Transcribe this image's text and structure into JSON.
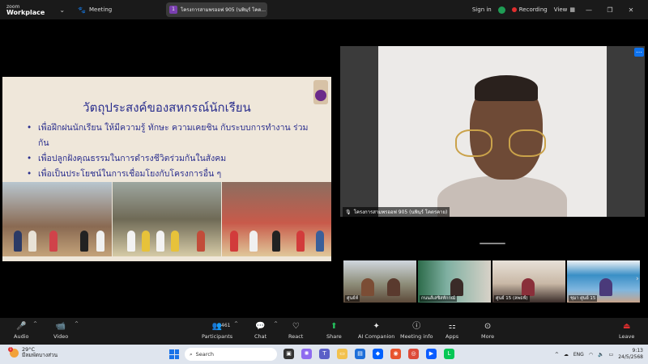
{
  "app": {
    "logo_line1": "zoom",
    "logo_line2": "Workplace",
    "meeting_label": "Meeting",
    "tab_number": "1",
    "tab_title": "โครงการสามพรออฟ 905 (นพินฺร์ โคต..."
  },
  "titlebar_right": {
    "signin": "Sign in",
    "recording": "Recording",
    "view": "View"
  },
  "slide": {
    "title": "วัตถุประสงค์ของสหกรณ์นักเรียน",
    "bullets": [
      "เพื่อฝึกฝนนักเรียน ให้มีความรู้ ทักษะ ความเคยชิน กับระบบการทำงาน ร่วมกัน",
      "เพื่อปลูกฝังคุณธรรมในการดำรงชีวิตร่วมกันในสังคม",
      "เพื่อเป็นประโยชน์ในการเชื่อมโยงกับโครงการอื่น ๆ"
    ]
  },
  "speaker": {
    "name": "โครงการสามพรออฟ 905 (นพินฺร์ โคตรคาย)"
  },
  "thumbnails": [
    {
      "label": "ศูนย์ห์"
    },
    {
      "label": "กนนส์เสซิสทักกณ์"
    },
    {
      "label": "ศูนย์ 15 (ลพธฟ์)"
    },
    {
      "label": "ชุมา ศูนย์ 15"
    }
  ],
  "toolbar": {
    "audio": "Audio",
    "video": "Video",
    "participants": "Participants",
    "participants_count": "461",
    "chat": "Chat",
    "react": "React",
    "share": "Share",
    "ai_companion": "AI Companion",
    "meeting_info": "Meeting info",
    "apps": "Apps",
    "more": "More",
    "leave": "Leave"
  },
  "taskbar": {
    "weather_badge": "1",
    "temperature": "29°C",
    "weather_text": "มีลมพัดบางส่วน",
    "search_placeholder": "Search",
    "language": "ENG",
    "time": "9:13",
    "date": "24/5/2568"
  },
  "colors": {
    "zoom_blue": "#0e72ed",
    "recording_red": "#e02e2e",
    "share_green": "#24c45e",
    "slide_text": "#2b2f8e"
  }
}
